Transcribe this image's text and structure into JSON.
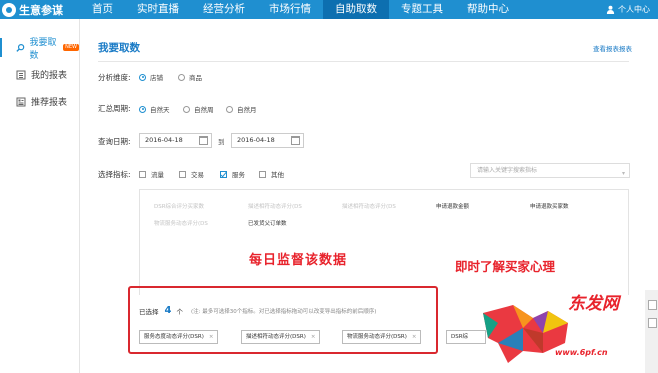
{
  "app": {
    "logo_text": "生意参谋"
  },
  "nav": {
    "items": [
      "首页",
      "实时直播",
      "经营分析",
      "市场行情",
      "自助取数",
      "专题工具",
      "帮助中心"
    ],
    "active_index": 4
  },
  "user": {
    "label": "个人中心"
  },
  "sidebar": {
    "items": [
      {
        "label": "我要取数",
        "badge": "NEW",
        "icon": "search-icon",
        "active": true
      },
      {
        "label": "我的报表",
        "icon": "list-icon"
      },
      {
        "label": "推荐报表",
        "icon": "report-icon"
      }
    ]
  },
  "page": {
    "title": "我要取数",
    "view_report": "查看报表报表"
  },
  "form": {
    "dimension": {
      "label": "分析维度:",
      "options": [
        "店铺",
        "商品"
      ],
      "selected": "店铺"
    },
    "period": {
      "label": "汇总周期:",
      "options": [
        "自然天",
        "自然周",
        "自然月"
      ],
      "selected": "自然天"
    },
    "date": {
      "label": "查询日期:",
      "start": "2016-04-18",
      "to": "到",
      "end": "2016-04-18"
    },
    "metrics": {
      "label": "选择指标:",
      "categories": [
        {
          "label": "流量",
          "checked": false
        },
        {
          "label": "交易",
          "checked": false
        },
        {
          "label": "服务",
          "checked": true
        },
        {
          "label": "其他",
          "checked": false
        }
      ],
      "search_placeholder": "请输入关键字搜索指标"
    }
  },
  "metric_options": [
    {
      "label": "DSR综合评分买家数",
      "selected": true
    },
    {
      "label": "描述相符动态评分(DS",
      "selected": true
    },
    {
      "label": "描述相符动态评分(DS",
      "selected": true
    },
    {
      "label": "申请退款金额",
      "selected": false
    },
    {
      "label": "申请退款买家数",
      "selected": false
    },
    {
      "label": "物流服务动态评分(DS",
      "selected": true
    },
    {
      "label": "已发货父订单数",
      "selected": false
    }
  ],
  "annotations": {
    "daily": "每日监督该数据",
    "right": "即时了解买家心理"
  },
  "selection": {
    "label": "已选择",
    "count": "4",
    "unit": "个",
    "note": "(注: 最多可选择30个指标。对已选择指标拖动可以改变导出指标的前后顺序)",
    "tags": [
      {
        "label": "服务态度动态评分(DSR)",
        "remove": "×"
      },
      {
        "label": "描述相符动态评分(DSR)",
        "remove": "×"
      },
      {
        "label": "物流服务动态评分(DSR)",
        "remove": "×"
      },
      {
        "label": "DSR综",
        "remove": ""
      }
    ]
  },
  "watermark": {
    "text": "东发网",
    "url": "www.6pf.cn"
  },
  "colors": {
    "nav_bg": "#1f8fd0",
    "nav_active": "#0d6fb0",
    "accent": "#1a7bc6",
    "highlight_red": "#d9282f"
  }
}
